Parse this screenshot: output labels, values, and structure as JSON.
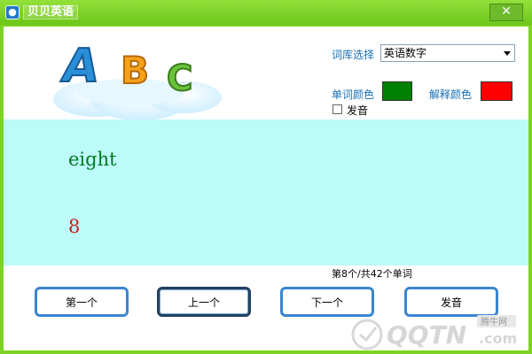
{
  "window": {
    "title": "贝贝英语",
    "close_glyph": "✕"
  },
  "settings": {
    "dict_label": "词库选择",
    "dict_value": "英语数字",
    "word_color_label": "单词颜色",
    "word_color": "#008000",
    "explain_color_label": "解释颜色",
    "explain_color": "#ff0000",
    "pronounce_checkbox_label": "发音",
    "pronounce_checked": false
  },
  "display": {
    "word": "eight",
    "meaning": "8"
  },
  "counter": "第8个/共42个单词",
  "buttons": {
    "first": "第一个",
    "prev": "上一个",
    "next": "下一个",
    "speak": "发音"
  },
  "logo": {
    "letters": "ABC"
  },
  "watermark": {
    "brand": "QQTN",
    "com": ".com",
    "site": "腾牛网"
  }
}
